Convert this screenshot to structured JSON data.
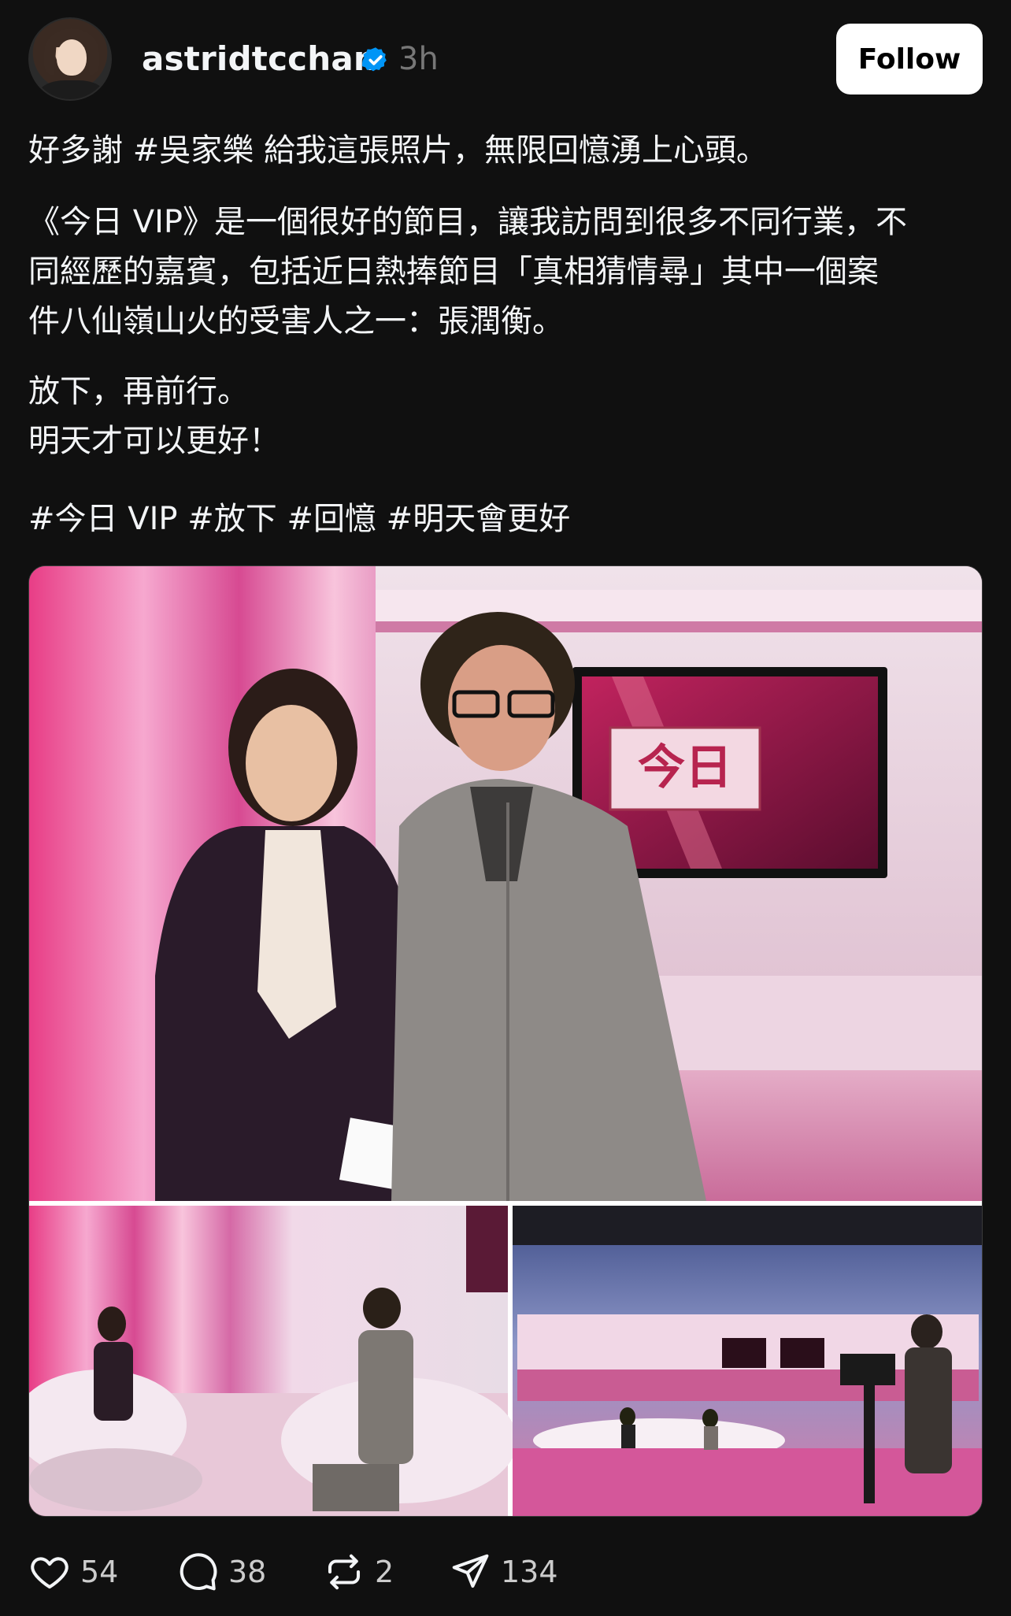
{
  "header": {
    "username": "astridtcchan",
    "verified_icon": "verified-badge-icon",
    "time": "3h",
    "follow_label": "Follow",
    "avatar_icon": "profile-avatar"
  },
  "post": {
    "paragraphs": [
      [
        "好多謝 #吳家樂 給我這張照片，無限回憶湧上心頭。"
      ],
      [
        "《今日 VIP》是一個很好的節目，讓我訪問到很多不同行業，不",
        "同經歷的嘉賓，包括近日熱捧節目「真相猜情尋」其中一個案",
        "件八仙嶺山火的受害人之一：張潤衡。"
      ],
      [
        "放下，再前行。",
        "明天才可以更好！"
      ],
      [
        "#今日 VIP #放下 #回憶 #明天會更好"
      ]
    ],
    "image_logo_text": "今日"
  },
  "actions": {
    "like_count": "54",
    "comment_count": "38",
    "repost_count": "2",
    "share_count": "134"
  },
  "colors": {
    "background": "#101010",
    "text": "#f3f5f7",
    "muted": "#777777",
    "verified": "#0095f6"
  }
}
